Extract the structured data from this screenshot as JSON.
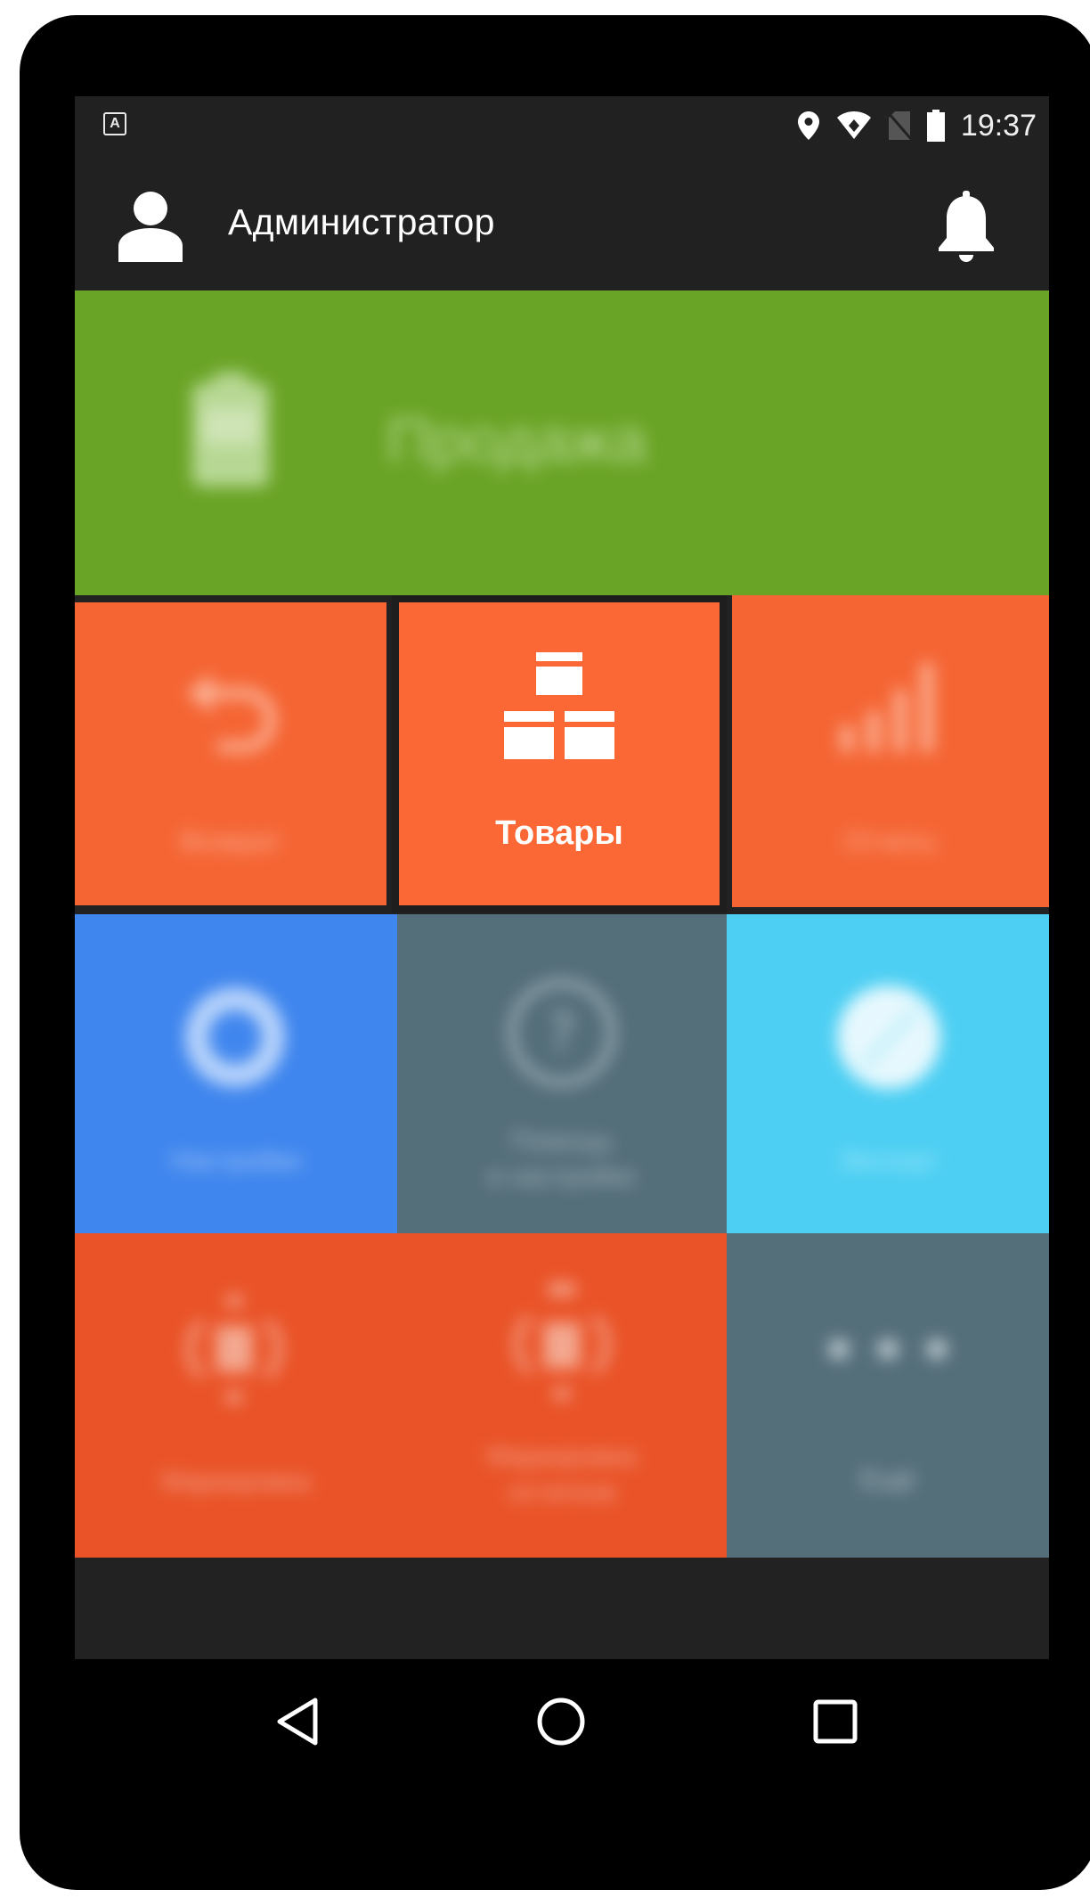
{
  "status_bar": {
    "keyboard_indicator": "A",
    "time": "19:37",
    "icons": [
      "location-icon",
      "wifi-icon",
      "no-sim-icon",
      "battery-icon"
    ]
  },
  "app_bar": {
    "title": "Администратор",
    "icons": [
      "user-avatar-icon",
      "bell-icon"
    ]
  },
  "tiles": {
    "sale": {
      "label": "Продажа",
      "icon": "payment-terminal-icon",
      "color": "#6aa426"
    },
    "return": {
      "label": "Возврат",
      "icon": "return-arrow-icon",
      "color": "#f56534"
    },
    "goods": {
      "label": "Товары",
      "icon": "boxes-icon",
      "color": "#fb6835"
    },
    "reports": {
      "label": "Отчеты",
      "icon": "bar-chart-icon",
      "color": "#f56534"
    },
    "settings": {
      "label": "Настройки",
      "icon": "gear-icon",
      "color": "#3f86ee"
    },
    "help": {
      "label_line1": "Помощь",
      "label_line2": "в настройке",
      "icon": "help-icon",
      "color": "#546e7a"
    },
    "extra": {
      "label": "Экспорт",
      "icon": "circle-icon",
      "color": "#4dcff3"
    },
    "marking": {
      "label": "Маркировка",
      "icon": "marking-icon",
      "color": "#ea5328"
    },
    "marking2": {
      "label_line1": "Маркировка",
      "label_line2": "остатков",
      "icon": "marking-icon",
      "color": "#ea5328"
    },
    "more": {
      "label": "Ещё",
      "icon": "more-dots-icon",
      "color": "#546e7a"
    }
  },
  "nav_bar": {
    "buttons": [
      "back-icon",
      "home-icon",
      "recents-icon"
    ]
  }
}
